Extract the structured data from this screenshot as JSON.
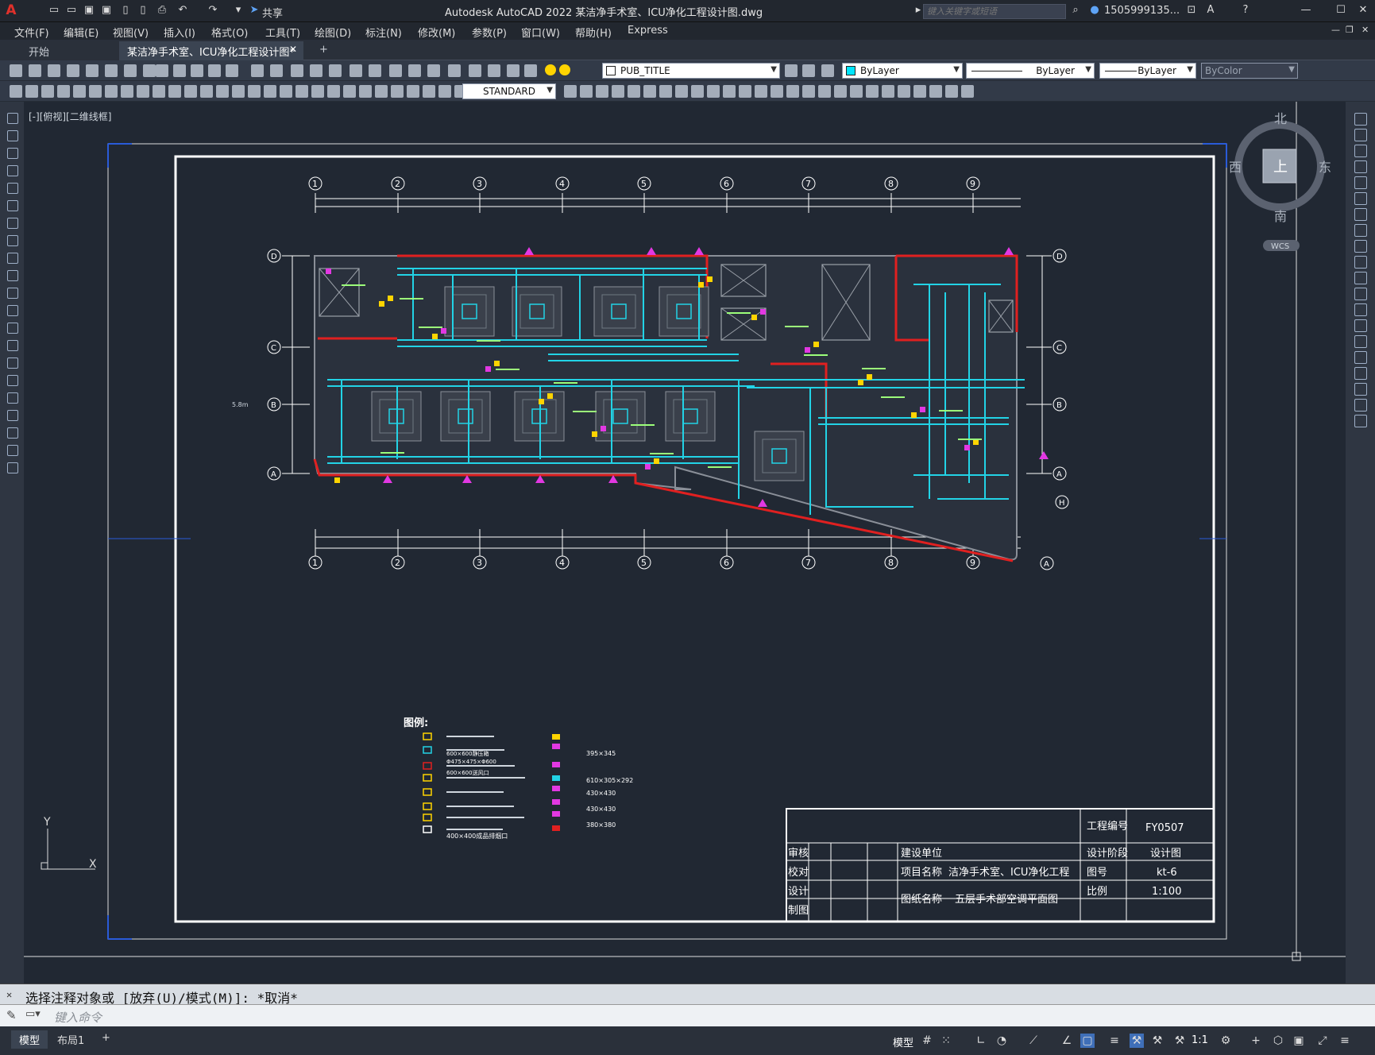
{
  "app": {
    "logo_letter": "A",
    "share_label": "共享",
    "window_title": "Autodesk AutoCAD 2022    某洁净手术室、ICU净化工程设计图.dwg",
    "search_placeholder": "键入关键字或短语",
    "user": "1505999135...",
    "help": "?"
  },
  "menu": [
    "文件(F)",
    "编辑(E)",
    "视图(V)",
    "插入(I)",
    "格式(O)",
    "工具(T)",
    "绘图(D)",
    "标注(N)",
    "修改(M)",
    "参数(P)",
    "窗口(W)",
    "帮助(H)",
    "Express"
  ],
  "tabs": {
    "start": "开始",
    "active": "某洁净手术室、ICU净化工程设计图*",
    "close": "✕",
    "add": "+"
  },
  "toolbar": {
    "layer": "PUB_TITLE",
    "color": "ByLayer",
    "linetype": "ByLayer",
    "lineweight": "ByLayer",
    "plotstyle": "ByColor",
    "textstyle": "STANDARD"
  },
  "viewport_label": "[-][俯视][二维线框]",
  "viewcube": {
    "north": "北",
    "south": "南",
    "east": "东",
    "west": "西",
    "face": "上",
    "wcs": "WCS"
  },
  "ucs": {
    "y": "Y",
    "x": "X"
  },
  "drawing": {
    "grid_top": [
      "1",
      "2",
      "3",
      "4",
      "5",
      "6",
      "7",
      "8",
      "9"
    ],
    "grid_side": [
      "D",
      "C",
      "B",
      "A"
    ],
    "grid_side_right_extra": [
      "H",
      "A"
    ],
    "side_tag": "5.8m",
    "legend_title": "图例:",
    "legend_left": [
      "600×600静压箱",
      "600×600送风口",
      "Φ475×475×Φ600",
      "400×400成品排烟口"
    ],
    "legend_right": [
      "395×345",
      "610×305×292",
      "430×430",
      "430×430",
      "380×380"
    ],
    "title_block": {
      "project_no_label": "工程编号",
      "project_no": "FY0507",
      "stage_label": "设计阶段",
      "stage": "设计图",
      "drawing_no_label": "图号",
      "drawing_no": "kt-6",
      "scale_label": "比例",
      "scale": "1:100",
      "sign_labels": [
        "审核",
        "校对",
        "设计",
        "制图"
      ],
      "build_unit_label": "建设单位",
      "project_name_label": "项目名称",
      "project_name": "洁净手术室、ICU净化工程",
      "drawing_name_label": "图纸名称",
      "drawing_name": "五层手术部空调平面图"
    }
  },
  "command": {
    "history": "选择注释对象或 [放弃(U)/模式(M)]: *取消*",
    "placeholder": "键入命令"
  },
  "status": {
    "layout_model": "模型",
    "layout_1": "布局1",
    "add": "+",
    "model_label": "模型",
    "scale": "1:1"
  }
}
